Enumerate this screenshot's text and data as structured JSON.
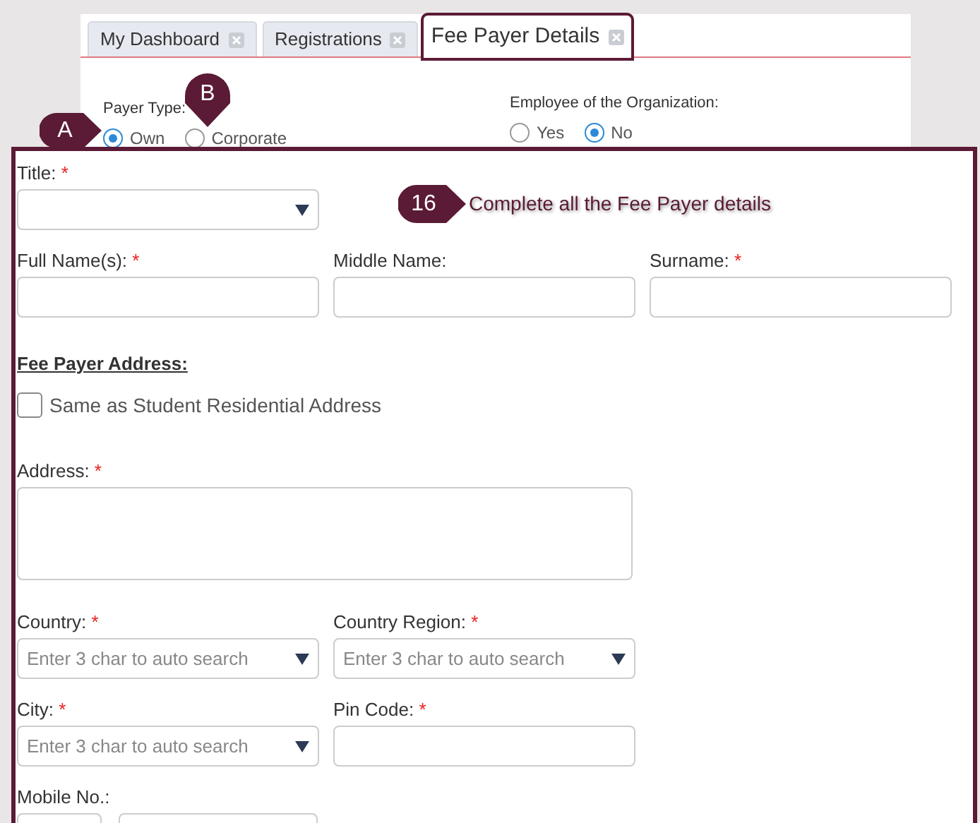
{
  "tabs": [
    {
      "label": "My Dashboard",
      "selected": false,
      "highlighted": false
    },
    {
      "label": "Registrations",
      "selected": false,
      "highlighted": false
    },
    {
      "label": "Fee Payer Details",
      "selected": true,
      "highlighted": true
    }
  ],
  "payer_type": {
    "label": "Payer Type:",
    "options": [
      {
        "label": "Own",
        "selected": true
      },
      {
        "label": "Corporate",
        "selected": false
      }
    ]
  },
  "employee": {
    "label": "Employee of the Organization:",
    "options": [
      {
        "label": "Yes",
        "selected": false
      },
      {
        "label": "No",
        "selected": true
      }
    ]
  },
  "callouts": [
    {
      "label": "A",
      "kind": "pin-right"
    },
    {
      "label": "B",
      "kind": "pin-down"
    },
    {
      "label": "16",
      "kind": "step",
      "text": "Complete all the Fee Payer details"
    }
  ],
  "form": {
    "rows": [
      [
        {
          "label": "Title:",
          "mark": "*",
          "kind": "select"
        }
      ],
      [
        {
          "label": "Full Name(s):",
          "mark": "*",
          "kind": "text"
        },
        {
          "label": "Middle Name:",
          "kind": "text"
        },
        {
          "label": "Surname:",
          "mark": "*",
          "kind": "text"
        }
      ]
    ],
    "address_heading": "Fee Payer Address:",
    "same_address": {
      "label": "Same as Student Residential Address",
      "checked": false
    },
    "address_rows": [
      [
        {
          "label": "Address:",
          "mark": "*",
          "kind": "textarea"
        }
      ],
      [
        {
          "label": "Country:",
          "mark": "*",
          "kind": "select",
          "placeholder": "Enter 3 char to auto search"
        },
        {
          "label": "Country Region:",
          "mark": "*",
          "kind": "select",
          "placeholder": "Enter 3 char to auto search"
        }
      ],
      [
        {
          "label": "City:",
          "mark": "*",
          "kind": "select",
          "placeholder": "Enter 3 char to auto search"
        },
        {
          "label": "Pin Code:",
          "mark": "*",
          "kind": "text"
        }
      ],
      [
        {
          "label": "Mobile No.:",
          "kind": "phone"
        }
      ]
    ]
  }
}
